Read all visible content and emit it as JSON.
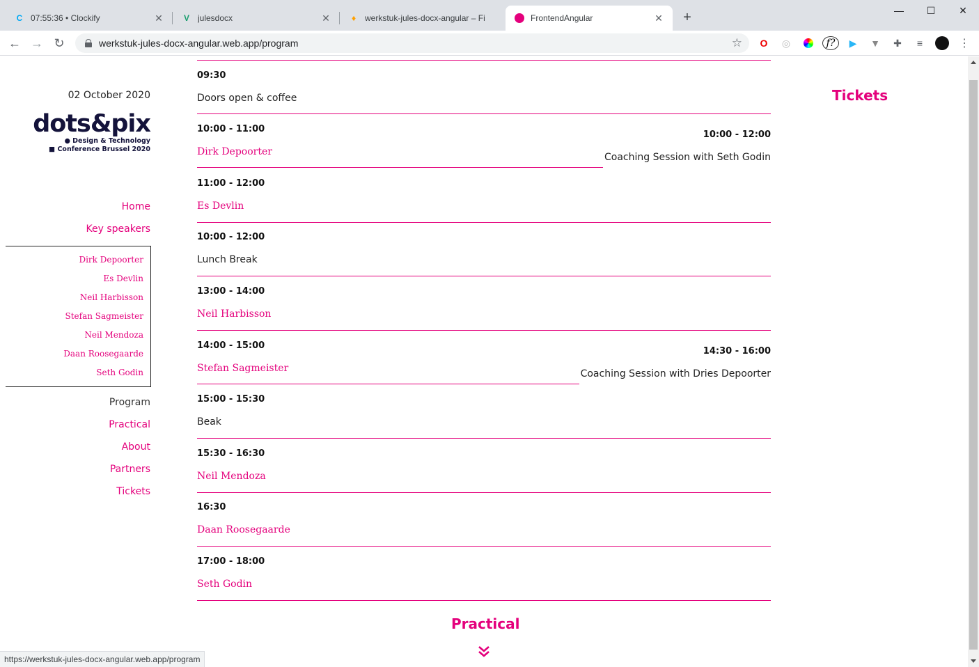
{
  "browser": {
    "tabs": [
      {
        "title": "07:55:36 • Clockify",
        "favicon": "clockify-icon"
      },
      {
        "title": "julesdocx",
        "favicon": "vue-icon"
      },
      {
        "title": "werkstuk-jules-docx-angular – Fi",
        "favicon": "firebase-icon"
      },
      {
        "title": "FrontendAngular",
        "favicon": "angular-icon"
      }
    ],
    "url": "werkstuk-jules-docx-angular.web.app/program",
    "status_url": "https://werkstuk-jules-docx-angular.web.app/program"
  },
  "site": {
    "date": "02 October 2020",
    "logo": {
      "wordmark": "dots&pix",
      "tagline_1": "● Design & Technology",
      "tagline_2": "■ Conference Brussel 2020"
    },
    "nav": {
      "home": "Home",
      "key_speakers": "Key speakers",
      "program": "Program",
      "practical": "Practical",
      "about": "About",
      "partners": "Partners",
      "tickets": "Tickets"
    },
    "speakers": [
      "Dirk Depoorter",
      "Es Devlin",
      "Neil Harbisson",
      "Stefan Sagmeister",
      "Neil Mendoza",
      "Daan Roosegaarde",
      "Seth Godin"
    ]
  },
  "program": {
    "items": [
      {
        "time": "09:30",
        "label": "Doors open & coffee",
        "type": "event"
      },
      {
        "time": "10:00 - 11:00",
        "label": "Dirk Depoorter",
        "type": "speaker"
      },
      {
        "time": "11:00 - 12:00",
        "label": "Es Devlin",
        "type": "speaker"
      },
      {
        "time": "10:00 - 12:00",
        "label": "Lunch Break",
        "type": "event"
      },
      {
        "time": "13:00 - 14:00",
        "label": "Neil Harbisson",
        "type": "speaker"
      },
      {
        "time": "14:00 - 15:00",
        "label": "Stefan Sagmeister",
        "type": "speaker"
      },
      {
        "time": "15:00 - 15:30",
        "label": "Beak",
        "type": "event"
      },
      {
        "time": "15:30 - 16:30",
        "label": "Neil Mendoza",
        "type": "speaker"
      },
      {
        "time": "16:30",
        "label": "Daan Roosegaarde",
        "type": "speaker"
      },
      {
        "time": "17:00 - 18:00",
        "label": "Seth Godin",
        "type": "speaker"
      }
    ],
    "coaching": [
      {
        "time": "10:00 - 12:00",
        "label": "Coaching Session with Seth Godin"
      },
      {
        "time": "14:30 - 16:00",
        "label": "Coaching Session with Dries Depoorter"
      }
    ]
  },
  "headings": {
    "tickets": "Tickets",
    "practical": "Practical"
  },
  "colors": {
    "accent": "#e4007c",
    "logo": "#14133b"
  }
}
